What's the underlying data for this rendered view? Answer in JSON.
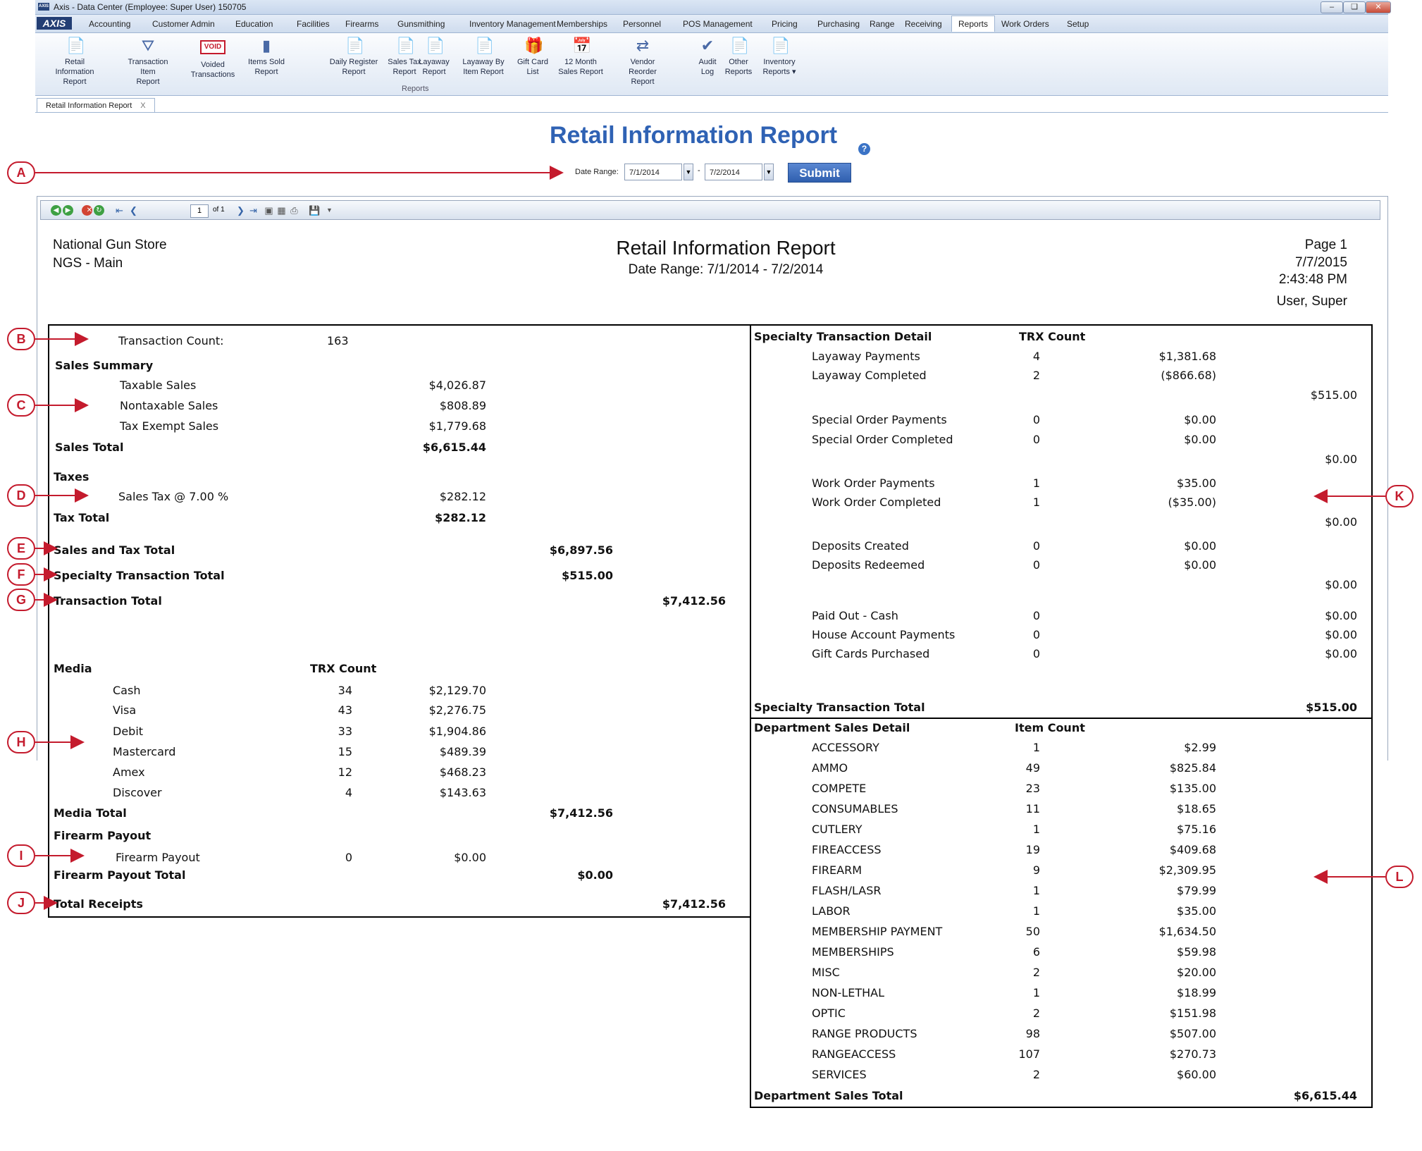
{
  "window": {
    "title": "Axis - Data Center  (Employee: Super User) 150705",
    "logo": "AXIS",
    "controls": [
      "minimize-icon",
      "restore-icon",
      "close-icon"
    ]
  },
  "menu": {
    "brand": "AXIS",
    "tabs": [
      "Accounting",
      "Customer Admin",
      "Education",
      "Facilities",
      "Firearms",
      "Gunsmithing",
      "Inventory Management",
      "Memberships",
      "Personnel",
      "POS Management",
      "Pricing",
      "Purchasing",
      "Range",
      "Receiving",
      "Reports",
      "Work Orders",
      "Setup"
    ],
    "active_tab": "Reports"
  },
  "ribbon": {
    "group_label": "Reports",
    "buttons": [
      {
        "label": "Retail Information\nReport",
        "icon": "report-icon"
      },
      {
        "label": "Transaction Item\nReport",
        "icon": "funnel-icon"
      },
      {
        "label": "Voided\nTransactions",
        "icon": "void-icon",
        "icon_text": "VOID"
      },
      {
        "label": "Items Sold\nReport",
        "icon": "bar-chart-icon"
      },
      {
        "label": "Daily Register\nReport",
        "icon": "report-icon"
      },
      {
        "label": "Sales Tax\nReport",
        "icon": "report-icon"
      },
      {
        "label": "Layaway\nReport",
        "icon": "report-icon"
      },
      {
        "label": "Layaway By\nItem Report",
        "icon": "report-icon"
      },
      {
        "label": "Gift Card\nList",
        "icon": "gift-card-icon"
      },
      {
        "label": "12 Month\nSales Report",
        "icon": "calendar-icon"
      },
      {
        "label": "Vendor Reorder\nReport",
        "icon": "reorder-icon"
      },
      {
        "label": "Audit\nLog",
        "icon": "checkmark-icon"
      },
      {
        "label": "Other\nReports",
        "icon": "report-icon"
      },
      {
        "label": "Inventory\nReports ▾",
        "icon": "report-icon"
      }
    ]
  },
  "doc_tab": {
    "label": "Retail Information Report",
    "close": "X"
  },
  "page": {
    "title": "Retail Information Report",
    "date_range_label": "Date Range:",
    "date_from": "7/1/2014",
    "date_to": "7/2/2014",
    "date_separator": "-",
    "submit_label": "Submit"
  },
  "viewer_toolbar": {
    "page_number": "1",
    "page_of": "of 1",
    "icons": [
      "back-icon",
      "forward-icon",
      "stop-icon",
      "refresh-icon",
      "first-page-icon",
      "prev-page-icon",
      "next-page-icon",
      "last-page-icon",
      "print-layout-icon",
      "page-setup-icon",
      "print-icon",
      "export-icon"
    ]
  },
  "report": {
    "company": "National Gun Store",
    "store": "NGS - Main",
    "title": "Retail Information Report",
    "date_range": "Date Range: 7/1/2014 - 7/2/2014",
    "page": "Page 1",
    "date": "7/7/2015",
    "time": "2:43:48 PM",
    "user": "User, Super",
    "left": {
      "transaction_count_label": "Transaction Count:",
      "transaction_count": "163",
      "sales_summary_header": "Sales Summary",
      "taxable_sales_label": "Taxable Sales",
      "taxable_sales": "$4,026.87",
      "nontaxable_sales_label": "Nontaxable Sales",
      "nontaxable_sales": "$808.89",
      "tax_exempt_label": "Tax Exempt Sales",
      "tax_exempt": "$1,779.68",
      "sales_total_label": "Sales Total",
      "sales_total": "$6,615.44",
      "taxes_header": "Taxes",
      "sales_tax_label": "Sales Tax @ 7.00 %",
      "sales_tax": "$282.12",
      "tax_total_label": "Tax Total",
      "tax_total": "$282.12",
      "sales_and_tax_label": "Sales and Tax Total",
      "sales_and_tax": "$6,897.56",
      "specialty_total_label": "Specialty Transaction Total",
      "specialty_total": "$515.00",
      "transaction_total_label": "Transaction Total",
      "transaction_total": "$7,412.56",
      "media_header": "Media",
      "media_count_header": "TRX Count",
      "media": [
        {
          "name": "Cash",
          "count": "34",
          "amount": "$2,129.70"
        },
        {
          "name": "Visa",
          "count": "43",
          "amount": "$2,276.75"
        },
        {
          "name": "Debit",
          "count": "33",
          "amount": "$1,904.86"
        },
        {
          "name": "Mastercard",
          "count": "15",
          "amount": "$489.39"
        },
        {
          "name": "Amex",
          "count": "12",
          "amount": "$468.23"
        },
        {
          "name": "Discover",
          "count": "4",
          "amount": "$143.63"
        }
      ],
      "media_total_label": "Media Total",
      "media_total": "$7,412.56",
      "firearm_payout_header": "Firearm Payout",
      "firearm_payout_label": "Firearm Payout",
      "firearm_payout_count": "0",
      "firearm_payout_amount": "$0.00",
      "firearm_payout_total_label": "Firearm Payout Total",
      "firearm_payout_total": "$0.00",
      "total_receipts_label": "Total Receipts",
      "total_receipts": "$7,412.56"
    },
    "specialty": {
      "header": "Specialty Transaction Detail",
      "count_header": "TRX Count",
      "groups": [
        {
          "rows": [
            {
              "name": "Layaway Payments",
              "count": "4",
              "amount": "$1,381.68"
            },
            {
              "name": "Layaway Completed",
              "count": "2",
              "amount": "($866.68)"
            }
          ],
          "subtotal": "$515.00"
        },
        {
          "rows": [
            {
              "name": "Special Order Payments",
              "count": "0",
              "amount": "$0.00"
            },
            {
              "name": "Special Order Completed",
              "count": "0",
              "amount": "$0.00"
            }
          ],
          "subtotal": "$0.00"
        },
        {
          "rows": [
            {
              "name": "Work Order Payments",
              "count": "1",
              "amount": "$35.00"
            },
            {
              "name": "Work Order Completed",
              "count": "1",
              "amount": "($35.00)"
            }
          ],
          "subtotal": "$0.00"
        },
        {
          "rows": [
            {
              "name": "Deposits Created",
              "count": "0",
              "amount": "$0.00"
            },
            {
              "name": "Deposits Redeemed",
              "count": "0",
              "amount": "$0.00"
            }
          ],
          "subtotal": "$0.00"
        }
      ],
      "other_rows": [
        {
          "name": "Paid Out - Cash",
          "count": "0",
          "amount": "$0.00"
        },
        {
          "name": "House Account Payments",
          "count": "0",
          "amount": "$0.00"
        },
        {
          "name": "Gift Cards Purchased",
          "count": "0",
          "amount": "$0.00"
        }
      ],
      "total_label": "Specialty Transaction Total",
      "total": "$515.00"
    },
    "department": {
      "header": "Department Sales Detail",
      "count_header": "Item Count",
      "rows": [
        {
          "name": "ACCESSORY",
          "count": "1",
          "amount": "$2.99"
        },
        {
          "name": "AMMO",
          "count": "49",
          "amount": "$825.84"
        },
        {
          "name": "COMPETE",
          "count": "23",
          "amount": "$135.00"
        },
        {
          "name": "CONSUMABLES",
          "count": "11",
          "amount": "$18.65"
        },
        {
          "name": "CUTLERY",
          "count": "1",
          "amount": "$75.16"
        },
        {
          "name": "FIREACCESS",
          "count": "19",
          "amount": "$409.68"
        },
        {
          "name": "FIREARM",
          "count": "9",
          "amount": "$2,309.95"
        },
        {
          "name": "FLASH/LASR",
          "count": "1",
          "amount": "$79.99"
        },
        {
          "name": "LABOR",
          "count": "1",
          "amount": "$35.00"
        },
        {
          "name": "MEMBERSHIP PAYMENT",
          "count": "50",
          "amount": "$1,634.50"
        },
        {
          "name": "MEMBERSHIPS",
          "count": "6",
          "amount": "$59.98"
        },
        {
          "name": "MISC",
          "count": "2",
          "amount": "$20.00"
        },
        {
          "name": "NON-LETHAL",
          "count": "1",
          "amount": "$18.99"
        },
        {
          "name": "OPTIC",
          "count": "2",
          "amount": "$151.98"
        },
        {
          "name": "RANGE PRODUCTS",
          "count": "98",
          "amount": "$507.00"
        },
        {
          "name": "RANGEACCESS",
          "count": "107",
          "amount": "$270.73"
        },
        {
          "name": "SERVICES",
          "count": "2",
          "amount": "$60.00"
        }
      ],
      "total_label": "Department Sales Total",
      "total": "$6,615.44"
    }
  },
  "callouts": [
    "A",
    "B",
    "C",
    "D",
    "E",
    "F",
    "G",
    "H",
    "I",
    "J",
    "K",
    "L"
  ],
  "colors": {
    "callout": "#c41b2d",
    "title": "#2f62b4",
    "submit": "#2f5fae"
  }
}
